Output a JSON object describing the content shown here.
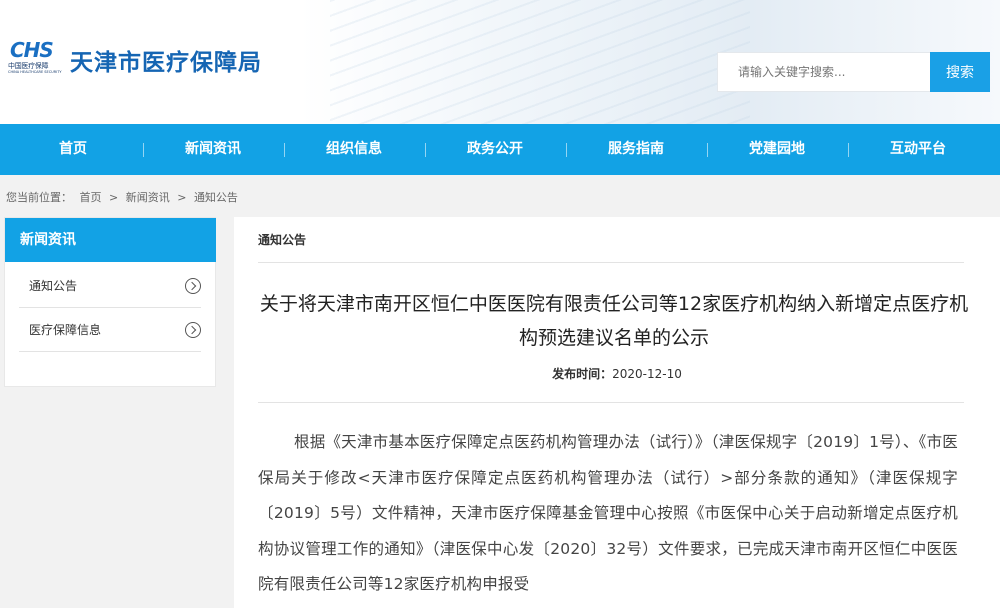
{
  "header": {
    "logo_mark": "CHS",
    "logo_sub": "中国医疗保障",
    "logo_sub2": "CHINA HEALTHCARE SECURITY",
    "site_title": "天津市医疗保障局"
  },
  "search": {
    "placeholder": "请输入关键字搜索...",
    "button_label": "搜索"
  },
  "nav": {
    "items": [
      {
        "label": "首页"
      },
      {
        "label": "新闻资讯"
      },
      {
        "label": "组织信息"
      },
      {
        "label": "政务公开"
      },
      {
        "label": "服务指南"
      },
      {
        "label": "党建园地"
      },
      {
        "label": "互动平台"
      }
    ]
  },
  "breadcrumb": {
    "prefix": "您当前位置：",
    "items": [
      "首页",
      "新闻资讯",
      "通知公告"
    ],
    "separator": ">"
  },
  "sidebar": {
    "title": "新闻资讯",
    "items": [
      {
        "label": "通知公告"
      },
      {
        "label": "医疗保障信息"
      }
    ]
  },
  "main": {
    "section_title": "通知公告",
    "article_title": "关于将天津市南开区恒仁中医医院有限责任公司等12家医疗机构纳入新增定点医疗机构预选建议名单的公示",
    "pub_label": "发布时间：",
    "pub_date": "2020-12-10",
    "body": "根据《天津市基本医疗保障定点医药机构管理办法（试行）》（津医保规字〔2019〕1号）、《市医保局关于修改<天津市医疗保障定点医药机构管理办法（试行）>部分条款的通知》（津医保规字〔2019〕5号）文件精神，天津市医疗保障基金管理中心按照《市医保中心关于启动新增定点医疗机构协议管理工作的通知》（津医保中心发〔2020〕32号）文件要求，已完成天津市南开区恒仁中医医院有限责任公司等12家医疗机构申报受"
  },
  "colors": {
    "accent": "#12a2e5",
    "title_blue": "#1565b3"
  }
}
